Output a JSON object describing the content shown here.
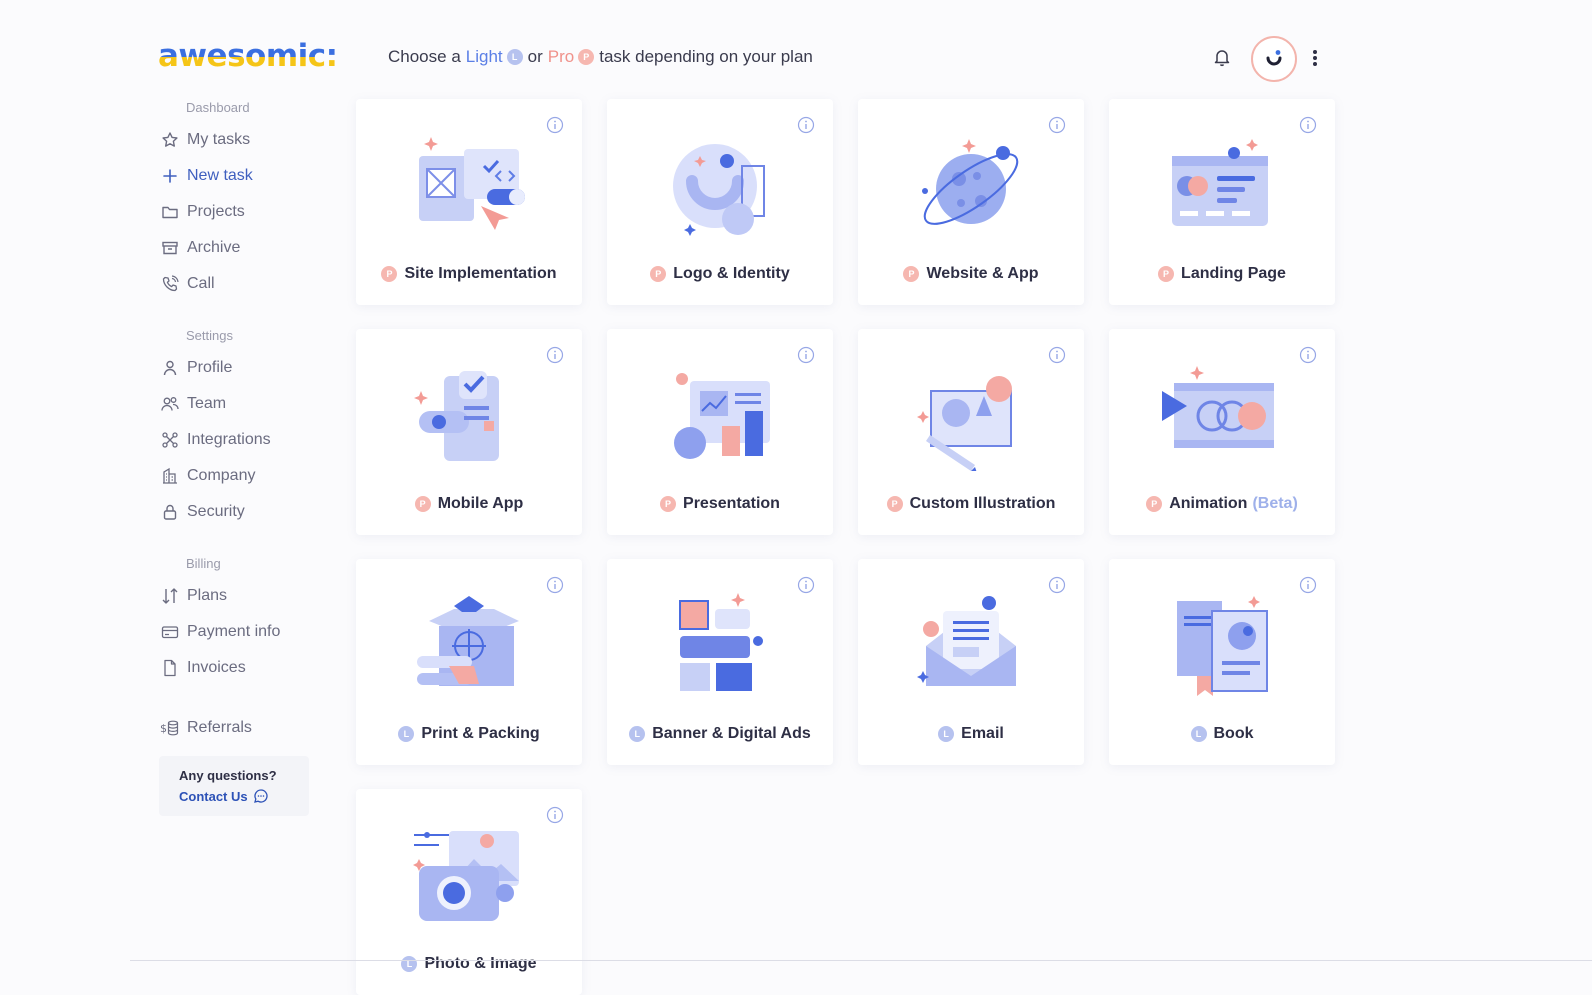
{
  "brand": {
    "name": "awesomic:"
  },
  "header": {
    "prefix": "Choose a",
    "light": "Light",
    "light_badge": "L",
    "or": "or",
    "pro": "Pro",
    "pro_badge": "P",
    "suffix": "task depending on your plan"
  },
  "sidebar": {
    "sections": [
      {
        "title": "Dashboard",
        "items": [
          {
            "label": "My tasks",
            "icon": "star-icon"
          },
          {
            "label": "New task",
            "icon": "plus-icon",
            "active": true
          },
          {
            "label": "Projects",
            "icon": "folder-icon"
          },
          {
            "label": "Archive",
            "icon": "archive-icon"
          },
          {
            "label": "Call",
            "icon": "phone-icon"
          }
        ]
      },
      {
        "title": "Settings",
        "items": [
          {
            "label": "Profile",
            "icon": "user-icon"
          },
          {
            "label": "Team",
            "icon": "team-icon"
          },
          {
            "label": "Integrations",
            "icon": "integrations-icon"
          },
          {
            "label": "Company",
            "icon": "building-icon"
          },
          {
            "label": "Security",
            "icon": "lock-icon"
          }
        ]
      },
      {
        "title": "Billing",
        "items": [
          {
            "label": "Plans",
            "icon": "sort-arrows-icon"
          },
          {
            "label": "Payment info",
            "icon": "credit-card-icon"
          },
          {
            "label": "Invoices",
            "icon": "file-icon"
          }
        ]
      }
    ],
    "referrals": {
      "label": "Referrals",
      "icon": "coins-icon"
    },
    "help": {
      "question": "Any questions?",
      "link": "Contact Us"
    }
  },
  "tasks": [
    {
      "label": "Site Implementation",
      "badge": "P"
    },
    {
      "label": "Logo & Identity",
      "badge": "P"
    },
    {
      "label": "Website & App",
      "badge": "P"
    },
    {
      "label": "Landing Page",
      "badge": "P"
    },
    {
      "label": "Mobile App",
      "badge": "P"
    },
    {
      "label": "Presentation",
      "badge": "P"
    },
    {
      "label": "Custom Illustration",
      "badge": "P"
    },
    {
      "label": "Animation",
      "badge": "P",
      "suffix": "(Beta)"
    },
    {
      "label": "Print & Packing",
      "badge": "L"
    },
    {
      "label": "Banner & Digital Ads",
      "badge": "L"
    },
    {
      "label": "Email",
      "badge": "L"
    },
    {
      "label": "Book",
      "badge": "L"
    },
    {
      "label": "Photo & Image",
      "badge": "L"
    }
  ],
  "colors": {
    "accent_blue": "#5b7fe6",
    "pro_pink": "#f0928b",
    "light_badge": "#b6c2ef",
    "pro_badge": "#f6b7b0"
  }
}
